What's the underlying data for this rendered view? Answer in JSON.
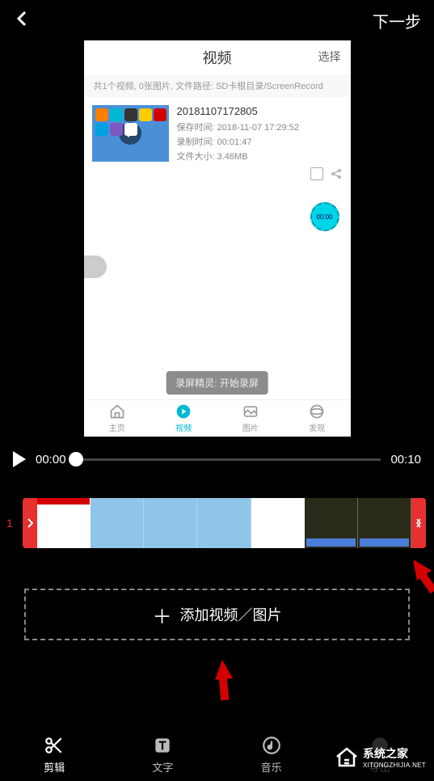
{
  "topbar": {
    "next_label": "下一步"
  },
  "preview": {
    "title": "视频",
    "select_label": "选择",
    "summary": "共1个视频, 0张图片, 文件路径: SD卡根目录/ScreenRecord",
    "video": {
      "name": "20181107172805",
      "saved_at_label": "保存时间:",
      "saved_at_value": "2018-11-07 17:29:52",
      "duration_label": "录制时间:",
      "duration_value": "00:01:47",
      "size_label": "文件大小:",
      "size_value": "3.46MB"
    },
    "timer": "00:00",
    "toast": "录屏精灵: 开始录屏",
    "tabs": [
      "主页",
      "视频",
      "图片",
      "发现"
    ]
  },
  "playback": {
    "current": "00:00",
    "total": "00:10"
  },
  "timeline": {
    "track_number": "1"
  },
  "add_button": {
    "label": "添加视频／图片"
  },
  "bottom_nav": {
    "items": [
      "剪辑",
      "文字",
      "音乐",
      "导出"
    ]
  },
  "watermark": {
    "name": "系统之家",
    "url": "XITONGZHIJIA.NET"
  }
}
